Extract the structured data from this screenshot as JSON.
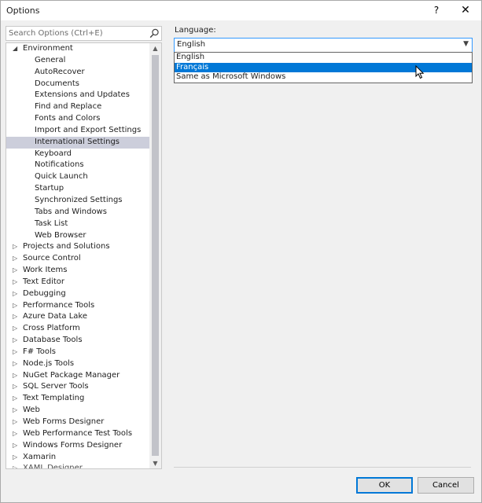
{
  "window": {
    "title": "Options",
    "help": "?",
    "close": "✕"
  },
  "search": {
    "placeholder": "Search Options (Ctrl+E)"
  },
  "tree": {
    "items": [
      {
        "label": "Environment",
        "level": 0,
        "expanded": true
      },
      {
        "label": "General",
        "level": 1
      },
      {
        "label": "AutoRecover",
        "level": 1
      },
      {
        "label": "Documents",
        "level": 1
      },
      {
        "label": "Extensions and Updates",
        "level": 1
      },
      {
        "label": "Find and Replace",
        "level": 1
      },
      {
        "label": "Fonts and Colors",
        "level": 1
      },
      {
        "label": "Import and Export Settings",
        "level": 1
      },
      {
        "label": "International Settings",
        "level": 1,
        "selected": true
      },
      {
        "label": "Keyboard",
        "level": 1
      },
      {
        "label": "Notifications",
        "level": 1
      },
      {
        "label": "Quick Launch",
        "level": 1
      },
      {
        "label": "Startup",
        "level": 1
      },
      {
        "label": "Synchronized Settings",
        "level": 1
      },
      {
        "label": "Tabs and Windows",
        "level": 1
      },
      {
        "label": "Task List",
        "level": 1
      },
      {
        "label": "Web Browser",
        "level": 1
      },
      {
        "label": "Projects and Solutions",
        "level": 0
      },
      {
        "label": "Source Control",
        "level": 0
      },
      {
        "label": "Work Items",
        "level": 0
      },
      {
        "label": "Text Editor",
        "level": 0
      },
      {
        "label": "Debugging",
        "level": 0
      },
      {
        "label": "Performance Tools",
        "level": 0
      },
      {
        "label": "Azure Data Lake",
        "level": 0
      },
      {
        "label": "Cross Platform",
        "level": 0
      },
      {
        "label": "Database Tools",
        "level": 0
      },
      {
        "label": "F# Tools",
        "level": 0
      },
      {
        "label": "Node.js Tools",
        "level": 0
      },
      {
        "label": "NuGet Package Manager",
        "level": 0
      },
      {
        "label": "SQL Server Tools",
        "level": 0
      },
      {
        "label": "Text Templating",
        "level": 0
      },
      {
        "label": "Web",
        "level": 0
      },
      {
        "label": "Web Forms Designer",
        "level": 0
      },
      {
        "label": "Web Performance Test Tools",
        "level": 0
      },
      {
        "label": "Windows Forms Designer",
        "level": 0
      },
      {
        "label": "Xamarin",
        "level": 0
      },
      {
        "label": "XAML Designer",
        "level": 0
      }
    ]
  },
  "language": {
    "label": "Language:",
    "selected": "English",
    "options": [
      "English",
      "Français",
      "Same as Microsoft Windows"
    ],
    "highlighted_index": 1
  },
  "buttons": {
    "ok": "OK",
    "cancel": "Cancel"
  },
  "colors": {
    "selection": "#cccedb",
    "highlight": "#0078d7",
    "focus_border": "#3399ff"
  }
}
